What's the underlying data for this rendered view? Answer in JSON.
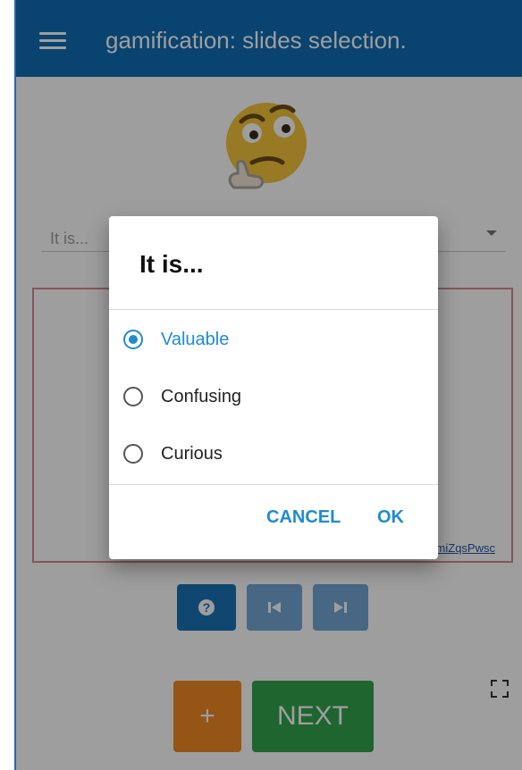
{
  "appbar": {
    "title": "gamification: slides selection."
  },
  "select": {
    "placeholder_text": "It is..."
  },
  "slide": {
    "link_text": "miZqsPwsc"
  },
  "controls": {
    "help_symbol": "?"
  },
  "actions": {
    "plus_label": "+",
    "next_label": "NEXT"
  },
  "dialog": {
    "title": "It is...",
    "options": [
      {
        "label": "Valuable",
        "selected": true
      },
      {
        "label": "Confusing",
        "selected": false
      },
      {
        "label": "Curious",
        "selected": false
      }
    ],
    "cancel_label": "CANCEL",
    "ok_label": "OK"
  },
  "colors": {
    "appbar": "#0f6db3",
    "accent": "#1f8ccf",
    "help_button": "#1a73b7",
    "nav_buttons": "#74a7d6",
    "plus_button": "#f08a23",
    "next_button": "#31a34c",
    "slide_border": "#d88a96"
  },
  "icons": {
    "menu": "hamburger-menu-icon",
    "emoji": "thinking-face-emoji-icon",
    "dropdown": "dropdown-arrow-icon",
    "help": "help-icon",
    "prev": "skip-previous-icon",
    "next": "skip-next-icon",
    "fullscreen": "fullscreen-icon"
  }
}
